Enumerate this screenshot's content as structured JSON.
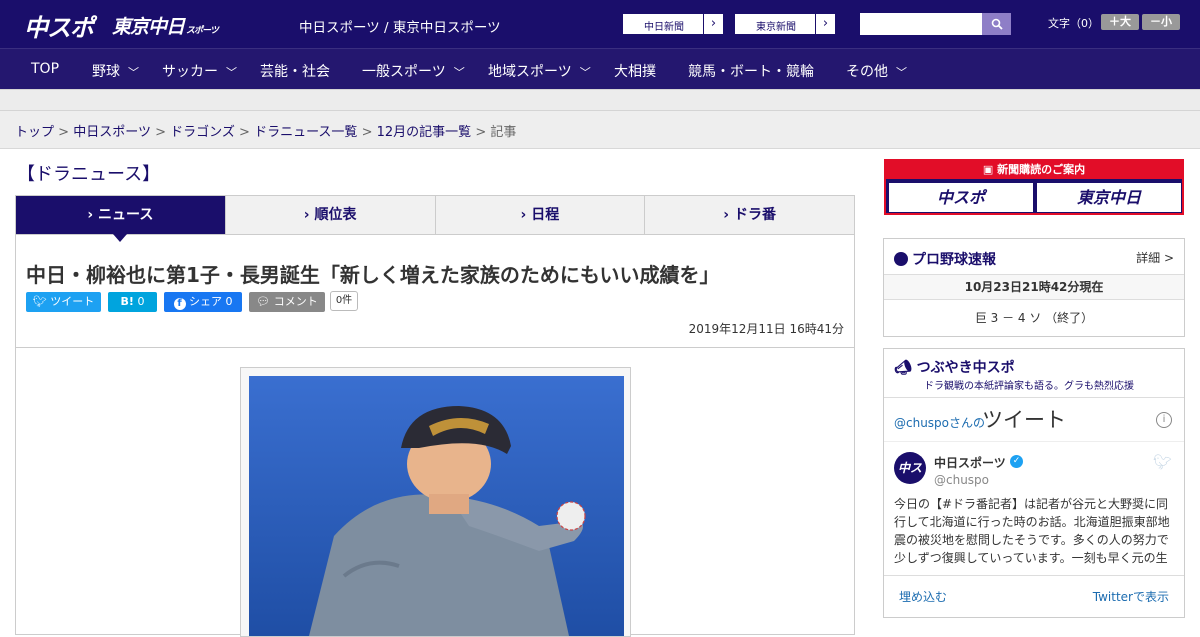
{
  "header": {
    "logo_chuspo": "中スポ",
    "logo_tokyo": "東京中日",
    "logo_tokyo_suffix": "スポーツ",
    "tagline": "中日スポーツ / 東京中日スポーツ",
    "paper_links": [
      {
        "label": "中日新聞"
      },
      {
        "label": "東京新聞"
      }
    ],
    "search": {
      "placeholder": ""
    },
    "font_size_label": "文字（0）",
    "font_larger": "＋大",
    "font_smaller": "－小"
  },
  "nav": {
    "items": [
      {
        "label": "TOP"
      },
      {
        "label": "野球"
      },
      {
        "label": "サッカー"
      },
      {
        "label": "芸能・社会"
      },
      {
        "label": "一般スポーツ"
      },
      {
        "label": "地域スポーツ"
      },
      {
        "label": "大相撲"
      },
      {
        "label": "競馬・ボート・競輪"
      },
      {
        "label": "その他"
      }
    ]
  },
  "breadcrumb": {
    "items": [
      "トップ",
      "中日スポーツ",
      "ドラゴンズ",
      "ドラニュース一覧",
      "12月の記事一覧"
    ],
    "current": "記事",
    "separator": ">"
  },
  "section_title": "【ドラニュース】",
  "tabs": [
    {
      "label": "ニュース",
      "active": true
    },
    {
      "label": "順位表"
    },
    {
      "label": "日程"
    },
    {
      "label": "ドラ番"
    }
  ],
  "article": {
    "headline": "中日・柳裕也に第1子・長男誕生「新しく増えた家族のためにもいい成績を」",
    "share": {
      "tweet": "ツイート",
      "hatena_logo": "B!",
      "hatena_count": "0",
      "facebook": "シェア",
      "facebook_count": "0",
      "comment": "コメント",
      "comment_count": "0件"
    },
    "date": "2019年12月11日 16時41分"
  },
  "sidebar": {
    "ad": {
      "title": "新聞購読のご案内",
      "logo1": "中スポ",
      "logo2": "東京中日"
    },
    "score": {
      "title": "プロ野球速報",
      "detail": "詳細 >",
      "time": "10月23日21時42分現在",
      "line": "巨 3 － 4 ソ （終了）"
    },
    "tsubuyaki": {
      "title": "つぶやき中スポ",
      "subtitle": "ドラ観戦の本紙評論家も語る。グラも熱烈応援",
      "handle_label": "@chuspoさんの",
      "timeline_title": "ツイート",
      "tweet": {
        "name": "中日スポーツ",
        "screen_name": "@chuspo",
        "text": "今日の【#ドラ番記者】は記者が谷元と大野奨に同行して北海道に行った時のお話。北海道胆振東部地震の被災地を慰問したそうです。多くの人の努力で少しずつ復興していっています。一刻も早く元の生"
      },
      "embed": "埋め込む",
      "view_on_twitter": "Twitterで表示"
    }
  },
  "colors": {
    "brand": "#1a0e6b",
    "accent": "#e20d28"
  },
  "icons": [
    "search-icon",
    "chevron-right-icon",
    "chevron-down-icon",
    "twitter-icon",
    "facebook-icon",
    "comment-icon",
    "newspaper-icon",
    "baseball-icon",
    "megaphone-icon",
    "info-icon",
    "verified-icon"
  ]
}
